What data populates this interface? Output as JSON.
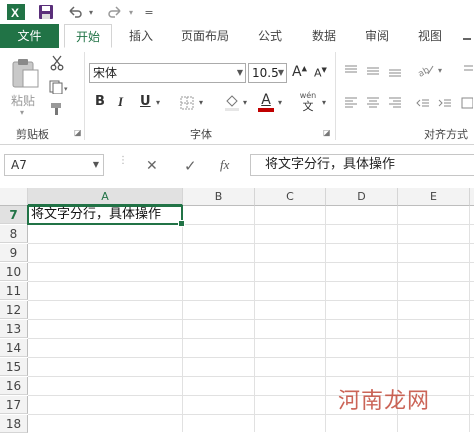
{
  "titlebar": {
    "app_icon": "excel-icon",
    "save_icon": "save-icon",
    "undo_icon": "undo-icon",
    "redo_icon": "redo-icon",
    "customize_glyph": "="
  },
  "tabs": [
    "文件",
    "开始",
    "插入",
    "页面布局",
    "公式",
    "数据",
    "审阅",
    "视图"
  ],
  "ribbon": {
    "clipboard": {
      "paste_label": "粘贴",
      "group_label": "剪贴板"
    },
    "font": {
      "font_name": "宋体",
      "font_size": "10.5",
      "grow_label": "A",
      "shrink_label": "A",
      "bold": "B",
      "italic": "I",
      "underline": "U",
      "font_color_label": "A",
      "phonetic_top": "wén",
      "phonetic_bottom": "文",
      "group_label": "字体"
    },
    "alignment": {
      "group_label": "对齐方式"
    }
  },
  "formula_bar": {
    "name_box": "A7",
    "cancel": "✕",
    "enter": "✓",
    "fx": "fx",
    "content": "将文字分行，具体操作"
  },
  "grid": {
    "columns": [
      "A",
      "B",
      "C",
      "D",
      "E"
    ],
    "rows": [
      "7",
      "8",
      "9",
      "10",
      "11",
      "12",
      "13",
      "14",
      "15",
      "16",
      "17",
      "18"
    ],
    "active_cell_text": "将文字分行，具体操作"
  },
  "watermark": "河南龙网",
  "colors": {
    "accent": "#217346",
    "font_color_bar": "#c00000",
    "watermark": "#c24a3a"
  }
}
